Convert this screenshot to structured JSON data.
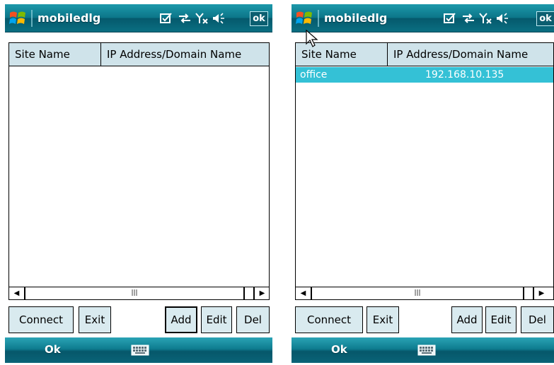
{
  "screens": [
    {
      "app_title": "mobiledlg",
      "ok_label": "ok",
      "list": {
        "columns": [
          "Site Name",
          "IP Address/Domain Name"
        ],
        "rows": []
      },
      "buttons": {
        "connect": "Connect",
        "exit": "Exit",
        "add": "Add",
        "edit": "Edit",
        "del": "Del"
      },
      "menu": {
        "left": "Ok"
      },
      "icons": [
        "windows-start-icon",
        "tasks-check-icon",
        "connectivity-arrows-icon",
        "signal-off-icon",
        "volume-icon",
        "keyboard-icon"
      ]
    },
    {
      "app_title": "mobiledlg",
      "ok_label": "ok",
      "list": {
        "columns": [
          "Site Name",
          "IP Address/Domain Name"
        ],
        "rows": [
          {
            "site": "office",
            "ip": "192.168.10.135",
            "selected": true
          }
        ]
      },
      "buttons": {
        "connect": "Connect",
        "exit": "Exit",
        "add": "Add",
        "edit": "Edit",
        "del": "Del"
      },
      "menu": {
        "left": "Ok"
      },
      "icons": [
        "windows-start-icon",
        "tasks-check-icon",
        "connectivity-arrows-icon",
        "signal-off-icon",
        "volume-icon",
        "keyboard-icon",
        "mouse-cursor-icon"
      ]
    }
  ],
  "colors": {
    "titlebar": "#0c7689",
    "header_fill": "#cfe3ea",
    "selection": "#34c1d6",
    "button_fill": "#d9eaef"
  }
}
